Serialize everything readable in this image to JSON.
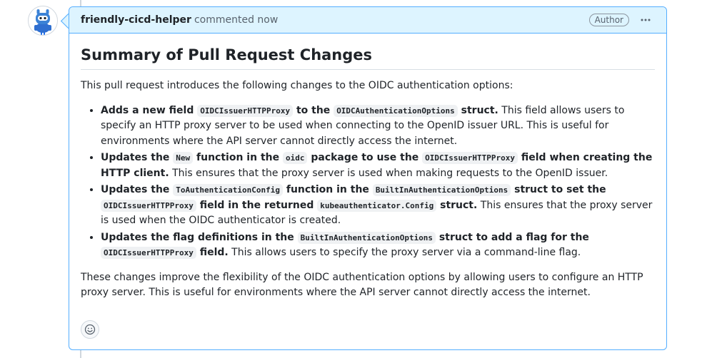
{
  "comment": {
    "author": "friendly-cicd-helper",
    "action_text": "commented now",
    "badge": "Author",
    "heading": "Summary of Pull Request Changes",
    "intro": "This pull request introduces the following changes to the OIDC authentication options:",
    "items": [
      {
        "b1": "Adds a new field ",
        "c1": "OIDCIssuerHTTPProxy",
        "b2": " to the ",
        "c2": "OIDCAuthenticationOptions",
        "b3": " struct.",
        "rest": " This field allows users to specify an HTTP proxy server to be used when connecting to the OpenID issuer URL. This is useful for environments where the API server cannot directly access the internet."
      },
      {
        "b1": "Updates the ",
        "c1": "New",
        "b2": " function in the ",
        "c2": "oidc",
        "b3": " package to use the ",
        "c3": "OIDCIssuerHTTPProxy",
        "b4": " field when creating the HTTP client.",
        "rest": " This ensures that the proxy server is used when making requests to the OpenID issuer."
      },
      {
        "b1": "Updates the ",
        "c1": "ToAuthenticationConfig",
        "b2": " function in the ",
        "c2": "BuiltInAuthenticationOptions",
        "b3": " struct to set the ",
        "c3": "OIDCIssuerHTTPProxy",
        "b4": " field in the returned ",
        "c4": "kubeauthenticator.Config",
        "b5": " struct.",
        "rest": " This ensures that the proxy server is used when the OIDC authenticator is created."
      },
      {
        "b1": "Updates the flag definitions in the ",
        "c1": "BuiltInAuthenticationOptions",
        "b2": " struct to add a flag for the ",
        "c2": "OIDCIssuerHTTPProxy",
        "b3": " field.",
        "rest": " This allows users to specify the proxy server via a command-line flag."
      }
    ],
    "conclusion": "These changes improve the flexibility of the OIDC authentication options by allowing users to configure an HTTP proxy server. This is useful for environments where the API server cannot directly access the internet."
  },
  "icons": {
    "avatar": "robot-avatar-icon",
    "more": "kebab-horizontal-icon",
    "reaction": "smiley-icon"
  },
  "colors": {
    "header_bg": "#ddf4ff",
    "border": "#54aeff",
    "text": "#1f2328",
    "muted": "#59636e"
  }
}
